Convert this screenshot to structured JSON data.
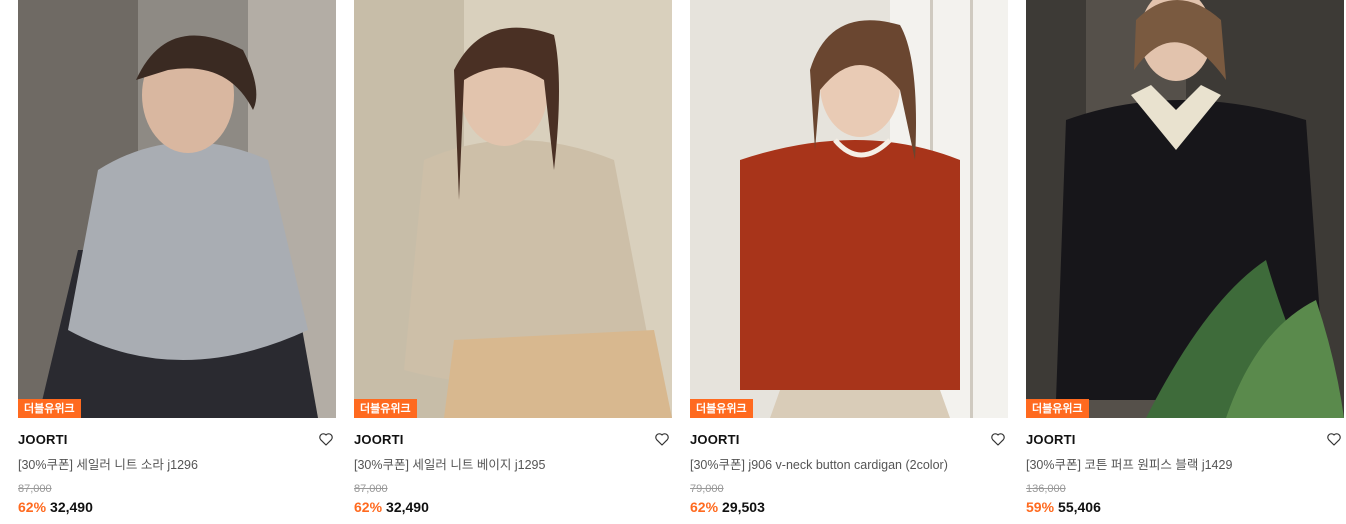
{
  "products": [
    {
      "badge": "더블유위크",
      "brand": "JOORTI",
      "name": "[30%쿠폰] 세일러 니트 소라 j1296",
      "original_price": "87,000",
      "discount": "62%",
      "price": "32,490",
      "wishlist_icon": "heart-outline-icon",
      "photo_colors": {
        "bg": "#8e8a84",
        "garment": "#a9adb3",
        "hair": "#3a2a22"
      }
    },
    {
      "badge": "더블유위크",
      "brand": "JOORTI",
      "name": "[30%쿠폰] 세일러 니트 베이지 j1295",
      "original_price": "87,000",
      "discount": "62%",
      "price": "32,490",
      "wishlist_icon": "heart-outline-icon",
      "photo_colors": {
        "bg": "#d9d0bd",
        "garment": "#cdbfa8",
        "hair": "#4a3024"
      }
    },
    {
      "badge": "더블유위크",
      "brand": "JOORTI",
      "name": "[30%쿠폰] j906 v-neck button cardigan (2color)",
      "original_price": "79,000",
      "discount": "62%",
      "price": "29,503",
      "wishlist_icon": "heart-outline-icon",
      "photo_colors": {
        "bg": "#e6e3dc",
        "garment": "#a8341a",
        "hair": "#6a4630"
      }
    },
    {
      "badge": "더블유위크",
      "brand": "JOORTI",
      "name": "[30%쿠폰] 코튼 퍼프 원피스 블랙 j1429",
      "original_price": "136,000",
      "discount": "59%",
      "price": "55,406",
      "wishlist_icon": "heart-outline-icon",
      "photo_colors": {
        "bg": "#3d3a36",
        "garment": "#17161a",
        "hair": "#7a5a40"
      }
    }
  ],
  "colors": {
    "accent": "#ff6a1f",
    "strike": "#999999",
    "name_text": "#555555"
  }
}
